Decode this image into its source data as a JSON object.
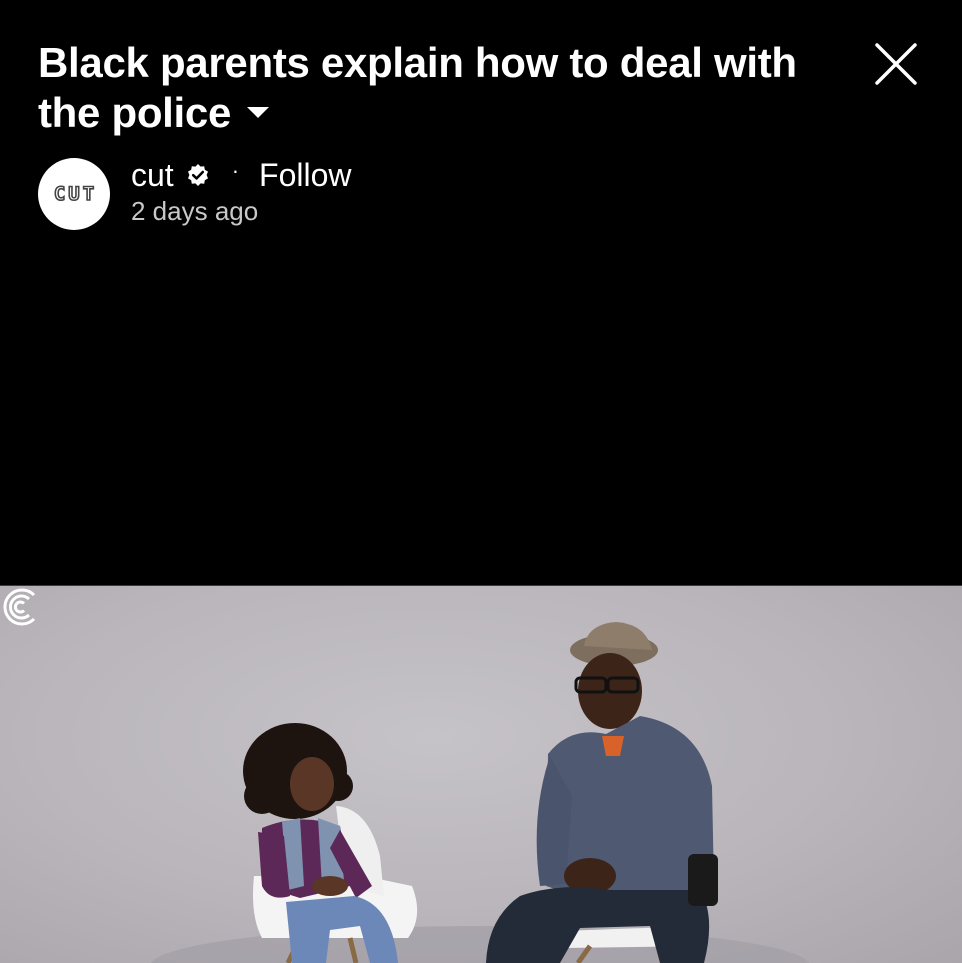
{
  "header": {
    "title_line1": "Black parents explain how to deal with",
    "title_line2": "the police",
    "close_icon": "close-icon",
    "expand_icon": "caret-down-icon"
  },
  "channel": {
    "avatar_text": "CUT",
    "name": "cut",
    "verified_icon": "verified-badge-icon",
    "separator": "·",
    "follow_label": "Follow",
    "posted": "2 days ago"
  },
  "video": {
    "watermark_icon": "cut-logo-icon"
  },
  "colors": {
    "background": "#000000",
    "text": "#ffffff",
    "secondary_text": "#c8c8c8",
    "video_backdrop": "#bdb9bf"
  }
}
